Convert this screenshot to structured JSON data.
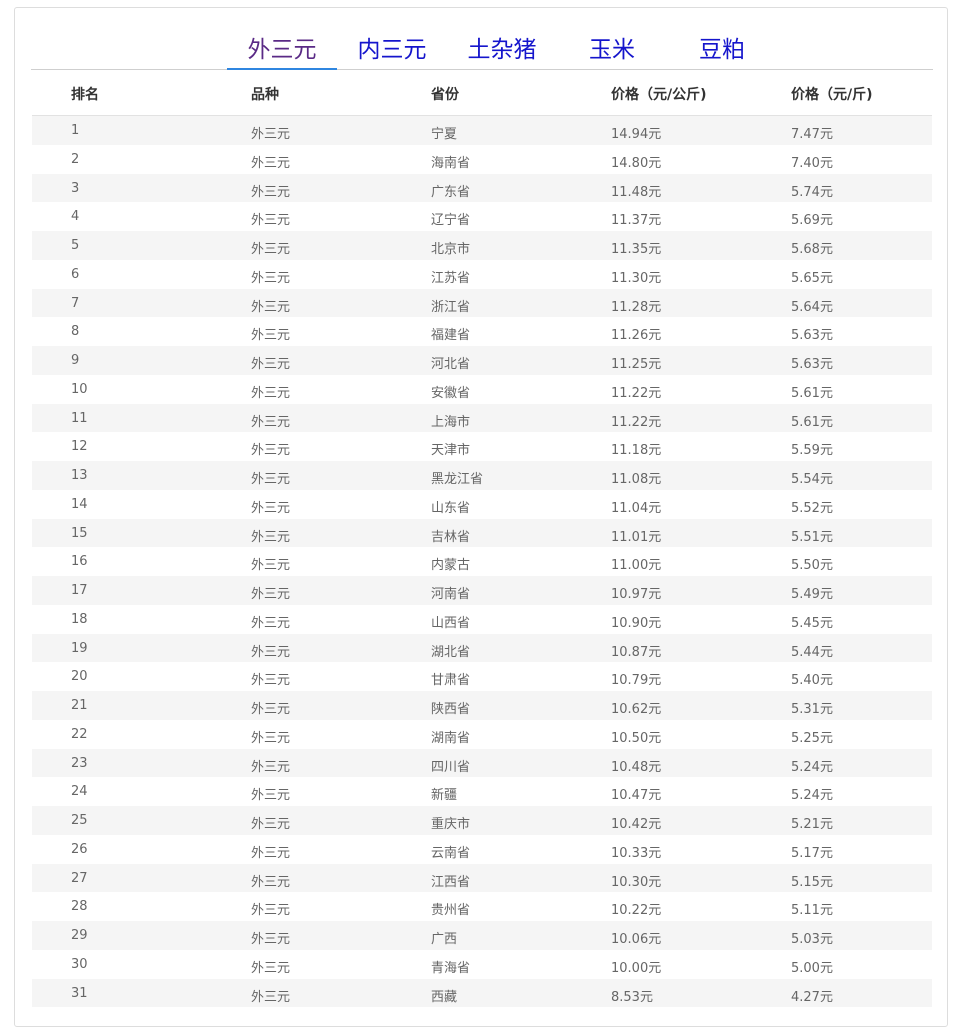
{
  "tabs": [
    {
      "label": "外三元",
      "active": true
    },
    {
      "label": "内三元",
      "active": false
    },
    {
      "label": "土杂猪",
      "active": false
    },
    {
      "label": "玉米",
      "active": false
    },
    {
      "label": "豆粕",
      "active": false
    }
  ],
  "table": {
    "headers": [
      "排名",
      "品种",
      "省份",
      "价格（元/公斤)",
      "价格（元/斤)"
    ],
    "rows": [
      [
        "1",
        "外三元",
        "宁夏",
        "14.94元",
        "7.47元"
      ],
      [
        "2",
        "外三元",
        "海南省",
        "14.80元",
        "7.40元"
      ],
      [
        "3",
        "外三元",
        "广东省",
        "11.48元",
        "5.74元"
      ],
      [
        "4",
        "外三元",
        "辽宁省",
        "11.37元",
        "5.69元"
      ],
      [
        "5",
        "外三元",
        "北京市",
        "11.35元",
        "5.68元"
      ],
      [
        "6",
        "外三元",
        "江苏省",
        "11.30元",
        "5.65元"
      ],
      [
        "7",
        "外三元",
        "浙江省",
        "11.28元",
        "5.64元"
      ],
      [
        "8",
        "外三元",
        "福建省",
        "11.26元",
        "5.63元"
      ],
      [
        "9",
        "外三元",
        "河北省",
        "11.25元",
        "5.63元"
      ],
      [
        "10",
        "外三元",
        "安徽省",
        "11.22元",
        "5.61元"
      ],
      [
        "11",
        "外三元",
        "上海市",
        "11.22元",
        "5.61元"
      ],
      [
        "12",
        "外三元",
        "天津市",
        "11.18元",
        "5.59元"
      ],
      [
        "13",
        "外三元",
        "黑龙江省",
        "11.08元",
        "5.54元"
      ],
      [
        "14",
        "外三元",
        "山东省",
        "11.04元",
        "5.52元"
      ],
      [
        "15",
        "外三元",
        "吉林省",
        "11.01元",
        "5.51元"
      ],
      [
        "16",
        "外三元",
        "内蒙古",
        "11.00元",
        "5.50元"
      ],
      [
        "17",
        "外三元",
        "河南省",
        "10.97元",
        "5.49元"
      ],
      [
        "18",
        "外三元",
        "山西省",
        "10.90元",
        "5.45元"
      ],
      [
        "19",
        "外三元",
        "湖北省",
        "10.87元",
        "5.44元"
      ],
      [
        "20",
        "外三元",
        "甘肃省",
        "10.79元",
        "5.40元"
      ],
      [
        "21",
        "外三元",
        "陕西省",
        "10.62元",
        "5.31元"
      ],
      [
        "22",
        "外三元",
        "湖南省",
        "10.50元",
        "5.25元"
      ],
      [
        "23",
        "外三元",
        "四川省",
        "10.48元",
        "5.24元"
      ],
      [
        "24",
        "外三元",
        "新疆",
        "10.47元",
        "5.24元"
      ],
      [
        "25",
        "外三元",
        "重庆市",
        "10.42元",
        "5.21元"
      ],
      [
        "26",
        "外三元",
        "云南省",
        "10.33元",
        "5.17元"
      ],
      [
        "27",
        "外三元",
        "江西省",
        "10.30元",
        "5.15元"
      ],
      [
        "28",
        "外三元",
        "贵州省",
        "10.22元",
        "5.11元"
      ],
      [
        "29",
        "外三元",
        "广西",
        "10.06元",
        "5.03元"
      ],
      [
        "30",
        "外三元",
        "青海省",
        "10.00元",
        "5.00元"
      ],
      [
        "31",
        "外三元",
        "西藏",
        "8.53元",
        "4.27元"
      ]
    ]
  },
  "colors": {
    "tab_text": "#1515cc",
    "tab_active_text": "#5a2a86",
    "tab_underline": "#2f86e0",
    "row_stripe": "#f5f5f5"
  }
}
